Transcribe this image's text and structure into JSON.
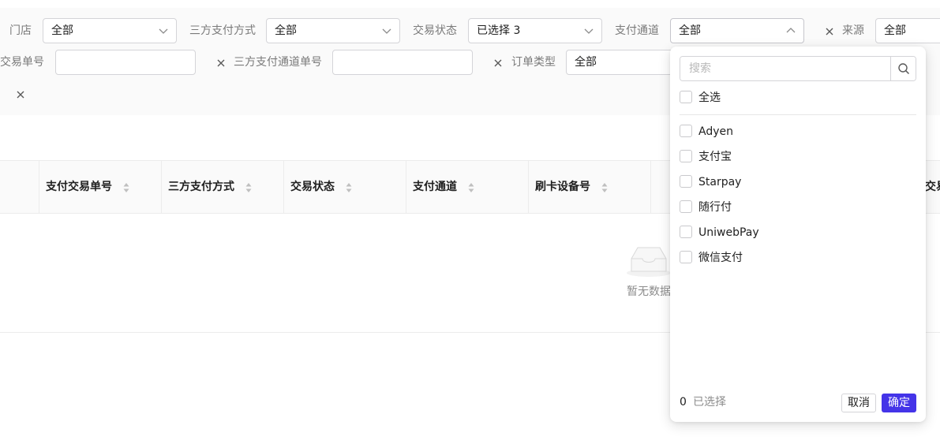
{
  "filters": {
    "store": {
      "label": "门店",
      "value": "全部"
    },
    "third_party_method": {
      "label": "三方支付方式",
      "value": "全部"
    },
    "txn_status": {
      "label": "交易状态",
      "value": "已选择 3"
    },
    "pay_channel": {
      "label": "支付通道",
      "value": "全部"
    },
    "source": {
      "label": "来源",
      "value": "全部"
    },
    "txn_no": {
      "label": "交易单号",
      "value": ""
    },
    "third_party_channel_no": {
      "label": "三方支付通道单号",
      "value": ""
    },
    "order_type": {
      "label": "订单类型",
      "value": "全部"
    }
  },
  "table": {
    "columns": [
      "支付交易单号",
      "三方支付方式",
      "交易状态",
      "支付通道",
      "刷卡设备号",
      "交易"
    ],
    "empty_text": "暂无数据"
  },
  "dropdown": {
    "search_placeholder": "搜索",
    "select_all": "全选",
    "options": [
      "Adyen",
      "支付宝",
      "Starpay",
      "随行付",
      "UniwebPay",
      "微信支付"
    ],
    "selected_count": "0",
    "selected_label": "已选择",
    "cancel": "取消",
    "confirm": "确定"
  },
  "colors": {
    "primary": "#4434e8",
    "panel_bg": "#fafafa",
    "border": "#d4d4d8"
  }
}
